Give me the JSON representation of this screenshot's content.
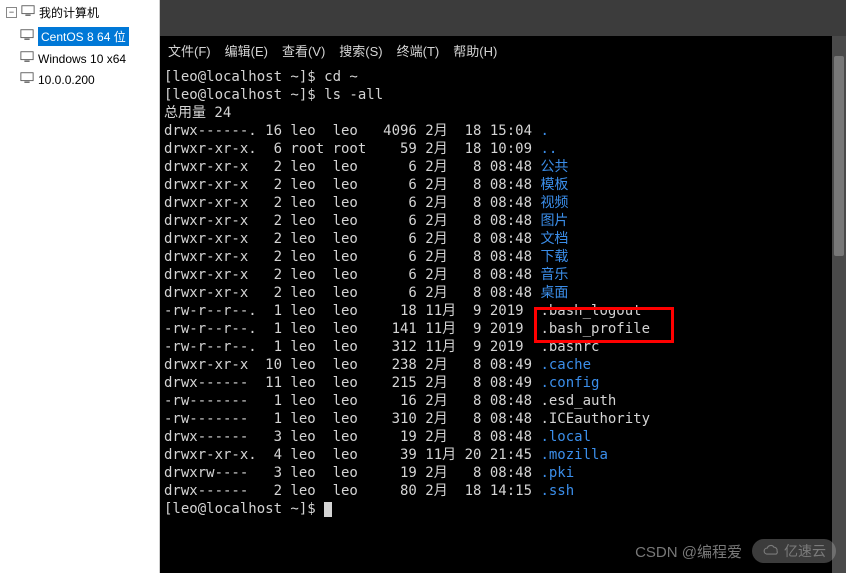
{
  "sidebar": {
    "root_label": "我的计算机",
    "items": [
      {
        "label": "CentOS 8 64 位",
        "selected": true
      },
      {
        "label": "Windows 10 x64",
        "selected": false
      },
      {
        "label": "10.0.0.200",
        "selected": false
      }
    ]
  },
  "menubar": {
    "items": [
      "文件(F)",
      "编辑(E)",
      "查看(V)",
      "搜索(S)",
      "终端(T)",
      "帮助(H)"
    ]
  },
  "terminal": {
    "prompt": "[leo@localhost ~]$",
    "commands": [
      {
        "prompt": "[leo@localhost ~]$ ",
        "cmd": "cd ~"
      },
      {
        "prompt": "[leo@localhost ~]$ ",
        "cmd": "ls -all"
      }
    ],
    "total_line": "总用量 24",
    "listing": [
      {
        "perm": "drwx------.",
        "links": "16",
        "owner": "leo ",
        "group": "leo ",
        "size": " 4096",
        "date": "2月  18 15:04",
        "name": ".",
        "color": "blue"
      },
      {
        "perm": "drwxr-xr-x.",
        "links": " 6",
        "owner": "root",
        "group": "root",
        "size": "   59",
        "date": "2月  18 10:09",
        "name": "..",
        "color": "blue"
      },
      {
        "perm": "drwxr-xr-x ",
        "links": " 2",
        "owner": "leo ",
        "group": "leo ",
        "size": "    6",
        "date": "2月   8 08:48",
        "name": "公共",
        "color": "blue"
      },
      {
        "perm": "drwxr-xr-x ",
        "links": " 2",
        "owner": "leo ",
        "group": "leo ",
        "size": "    6",
        "date": "2月   8 08:48",
        "name": "模板",
        "color": "blue"
      },
      {
        "perm": "drwxr-xr-x ",
        "links": " 2",
        "owner": "leo ",
        "group": "leo ",
        "size": "    6",
        "date": "2月   8 08:48",
        "name": "视频",
        "color": "blue"
      },
      {
        "perm": "drwxr-xr-x ",
        "links": " 2",
        "owner": "leo ",
        "group": "leo ",
        "size": "    6",
        "date": "2月   8 08:48",
        "name": "图片",
        "color": "blue"
      },
      {
        "perm": "drwxr-xr-x ",
        "links": " 2",
        "owner": "leo ",
        "group": "leo ",
        "size": "    6",
        "date": "2月   8 08:48",
        "name": "文档",
        "color": "blue"
      },
      {
        "perm": "drwxr-xr-x ",
        "links": " 2",
        "owner": "leo ",
        "group": "leo ",
        "size": "    6",
        "date": "2月   8 08:48",
        "name": "下载",
        "color": "blue"
      },
      {
        "perm": "drwxr-xr-x ",
        "links": " 2",
        "owner": "leo ",
        "group": "leo ",
        "size": "    6",
        "date": "2月   8 08:48",
        "name": "音乐",
        "color": "blue"
      },
      {
        "perm": "drwxr-xr-x ",
        "links": " 2",
        "owner": "leo ",
        "group": "leo ",
        "size": "    6",
        "date": "2月   8 08:48",
        "name": "桌面",
        "color": "blue"
      },
      {
        "perm": "-rw-r--r--.",
        "links": " 1",
        "owner": "leo ",
        "group": "leo ",
        "size": "   18",
        "date": "11月  9 2019 ",
        "name": ".bash_logout",
        "color": "white"
      },
      {
        "perm": "-rw-r--r--.",
        "links": " 1",
        "owner": "leo ",
        "group": "leo ",
        "size": "  141",
        "date": "11月  9 2019 ",
        "name": ".bash_profile",
        "color": "white",
        "highlight": true
      },
      {
        "perm": "-rw-r--r--.",
        "links": " 1",
        "owner": "leo ",
        "group": "leo ",
        "size": "  312",
        "date": "11月  9 2019 ",
        "name": ".bashrc",
        "color": "white"
      },
      {
        "perm": "drwxr-xr-x ",
        "links": "10",
        "owner": "leo ",
        "group": "leo ",
        "size": "  238",
        "date": "2月   8 08:49",
        "name": ".cache",
        "color": "blue"
      },
      {
        "perm": "drwx------ ",
        "links": "11",
        "owner": "leo ",
        "group": "leo ",
        "size": "  215",
        "date": "2月   8 08:49",
        "name": ".config",
        "color": "blue"
      },
      {
        "perm": "-rw------- ",
        "links": " 1",
        "owner": "leo ",
        "group": "leo ",
        "size": "   16",
        "date": "2月   8 08:48",
        "name": ".esd_auth",
        "color": "white"
      },
      {
        "perm": "-rw------- ",
        "links": " 1",
        "owner": "leo ",
        "group": "leo ",
        "size": "  310",
        "date": "2月   8 08:48",
        "name": ".ICEauthority",
        "color": "white"
      },
      {
        "perm": "drwx------ ",
        "links": " 3",
        "owner": "leo ",
        "group": "leo ",
        "size": "   19",
        "date": "2月   8 08:48",
        "name": ".local",
        "color": "blue"
      },
      {
        "perm": "drwxr-xr-x.",
        "links": " 4",
        "owner": "leo ",
        "group": "leo ",
        "size": "   39",
        "date": "11月 20 21:45",
        "name": ".mozilla",
        "color": "blue"
      },
      {
        "perm": "drwxrw---- ",
        "links": " 3",
        "owner": "leo ",
        "group": "leo ",
        "size": "   19",
        "date": "2月   8 08:48",
        "name": ".pki",
        "color": "blue"
      },
      {
        "perm": "drwx------ ",
        "links": " 2",
        "owner": "leo ",
        "group": "leo ",
        "size": "   80",
        "date": "2月  18 14:15",
        "name": ".ssh",
        "color": "blue"
      }
    ],
    "final_prompt": "[leo@localhost ~]$ "
  },
  "watermark": {
    "text": "CSDN @编程爱",
    "brand": "亿速云"
  }
}
